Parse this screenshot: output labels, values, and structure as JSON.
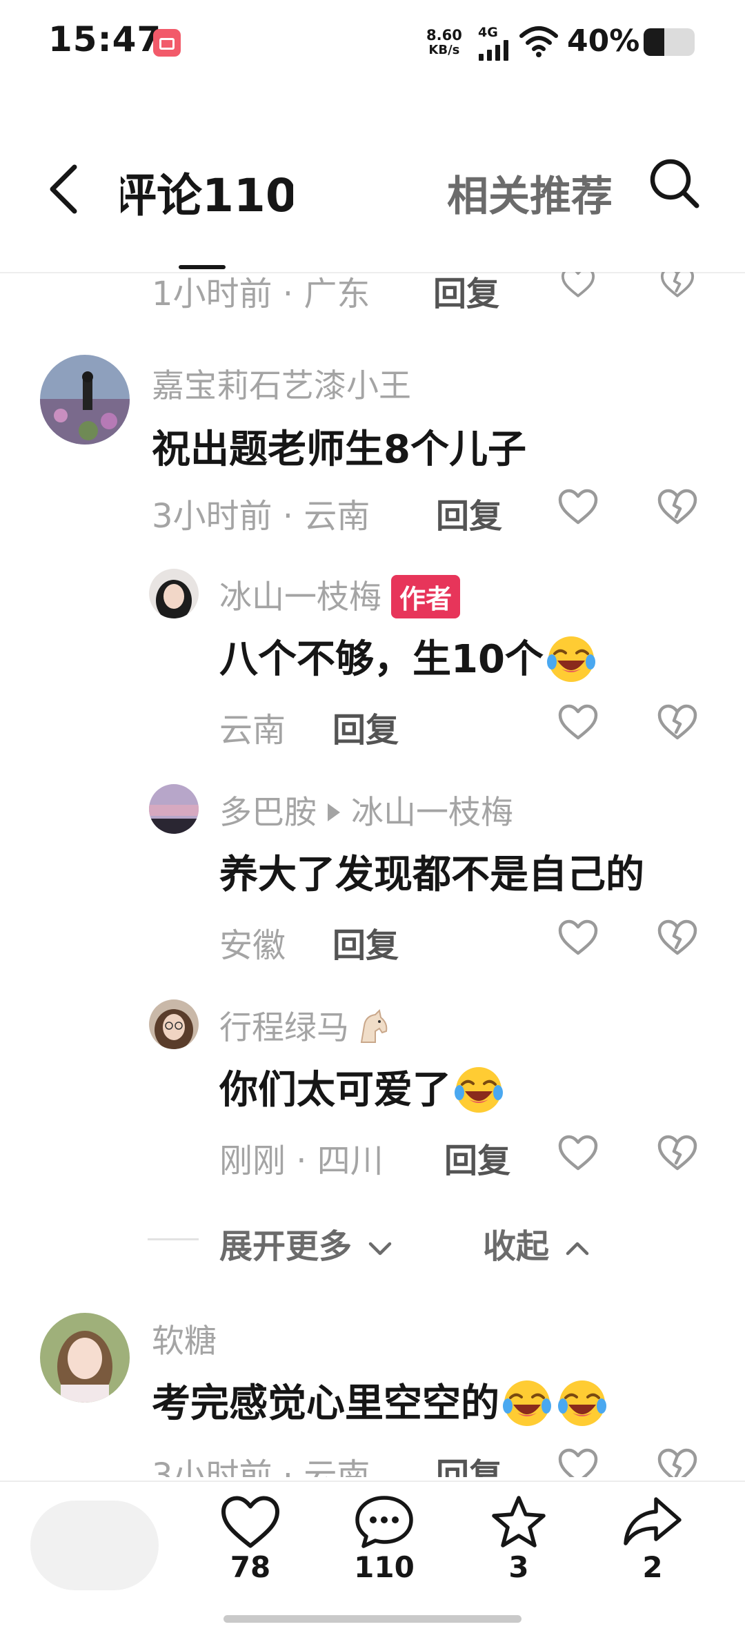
{
  "status_bar": {
    "time": "15:47",
    "net_speed_value": "8.60",
    "net_speed_unit": "KB/s",
    "net_type": "4G",
    "battery": "40%",
    "battery_level": 0.4
  },
  "header": {
    "comments_tab": "评论110",
    "related_tab": "相关推荐",
    "back_icon": "chevron-left-icon",
    "search_icon": "search-icon"
  },
  "partial_top_comment": {
    "time_location": "1小时前 · 广东",
    "reply_label": "回复"
  },
  "comments": [
    {
      "username": "嘉宝莉石艺漆小王",
      "text": "祝出题老师生8个儿子",
      "time_location": "3小时前 · 云南",
      "reply_label": "回复",
      "replies": [
        {
          "username": "冰山一枝梅",
          "badge": "作者",
          "text": "八个不够，生10个",
          "meta": "云南",
          "reply_label": "回复"
        },
        {
          "username": "多巴胺",
          "reply_to": "冰山一枝梅",
          "text": "养大了发现都不是自己的",
          "meta": "安徽",
          "reply_label": "回复"
        },
        {
          "username": "行程绿马",
          "text": "你们太可爱了",
          "meta": "刚刚 · 四川",
          "reply_label": "回复"
        }
      ],
      "expand_more": "展开更多",
      "collapse": "收起"
    },
    {
      "username": "软糖",
      "text": "考完感觉心里空空的",
      "time_location": "3小时前 · 云南",
      "reply_label": "回复"
    }
  ],
  "bottom_bar": {
    "likes": "78",
    "comments": "110",
    "favorites": "3",
    "shares": "2"
  },
  "colors": {
    "author_badge": "#e7355a",
    "muted_text": "#a4a4a4",
    "primary_text": "#161616"
  }
}
